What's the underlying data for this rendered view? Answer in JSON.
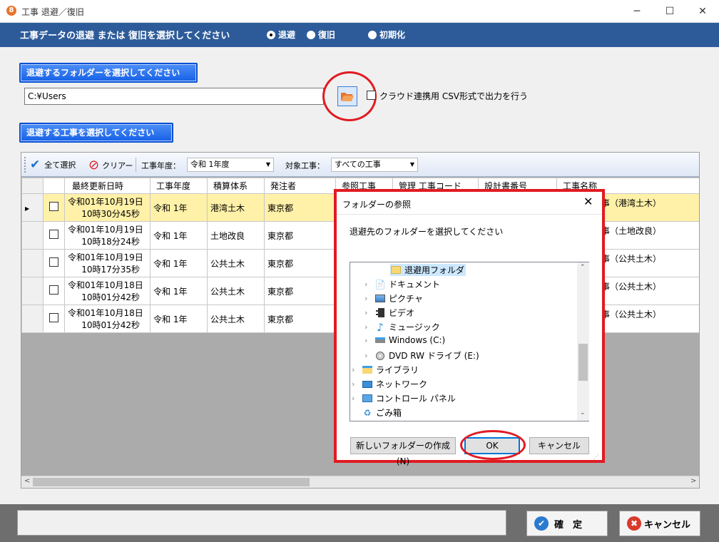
{
  "window": {
    "title": "工事 退避／復旧",
    "icon_glyph": "8"
  },
  "header": {
    "prompt": "工事データの退避 または 復旧を選択してください",
    "radios": [
      {
        "label": "退避",
        "selected": true
      },
      {
        "label": "復旧",
        "selected": false
      },
      {
        "label": "初期化",
        "selected": false
      }
    ]
  },
  "folder_section": {
    "select_label": "退避するフォルダーを選択してください",
    "path_value": "C:¥Users",
    "csv_option_label": "クラウド連携用 CSV形式で出力を行う",
    "csv_checked": false
  },
  "job_section": {
    "select_label": "退避する工事を選択してください"
  },
  "grid_toolbar": {
    "select_all": "全て選択",
    "clear": "クリアー",
    "year_label": "工事年度：",
    "year_value": "令和 1年度",
    "target_label": "対象工事：",
    "target_value": "すべての工事"
  },
  "table": {
    "columns": [
      "最終更新日時",
      "工事年度",
      "積算体系",
      "発注者",
      "参照工事",
      "管理 工事コード",
      "設計書番号",
      "工事名称"
    ],
    "rows": [
      {
        "date": "令和01年10月19日",
        "time": "10時30分45秒",
        "year": "令和 1年",
        "system": "港湾土木",
        "client": "東京都",
        "name": "事（港湾土木）"
      },
      {
        "date": "令和01年10月19日",
        "time": "10時18分24秒",
        "year": "令和 1年",
        "system": "土地改良",
        "client": "東京都",
        "name": "事（土地改良）"
      },
      {
        "date": "令和01年10月19日",
        "time": "10時17分35秒",
        "year": "令和 1年",
        "system": "公共土木",
        "client": "東京都",
        "name": "事（公共土木）"
      },
      {
        "date": "令和01年10月18日",
        "time": "10時01分42秒",
        "year": "令和 1年",
        "system": "公共土木",
        "client": "東京都",
        "name": "事（公共土木）"
      },
      {
        "date": "令和01年10月18日",
        "time": "10時01分42秒",
        "year": "令和 1年",
        "system": "公共土木",
        "client": "東京都",
        "name": "事（公共土木）"
      }
    ]
  },
  "footer": {
    "confirm": "確　定",
    "cancel": "キャンセル"
  },
  "dialog": {
    "title": "フォルダーの参照",
    "prompt": "退避先のフォルダーを選択してください",
    "tree": [
      "退避用フォルダ",
      "ドキュメント",
      "ピクチャ",
      "ビデオ",
      "ミュージック",
      "Windows (C:)",
      "DVD RW ドライブ (E:)",
      "ライブラリ",
      "ネットワーク",
      "コントロール パネル",
      "ごみ箱"
    ],
    "new_folder": "新しいフォルダーの作成(N)",
    "ok": "OK",
    "cancel": "キャンセル"
  },
  "colors": {
    "header_band": "#2d5b9a",
    "accent_blue": "#1661e6",
    "highlight_red": "#e11b22",
    "selected_row": "#fff1a8"
  }
}
